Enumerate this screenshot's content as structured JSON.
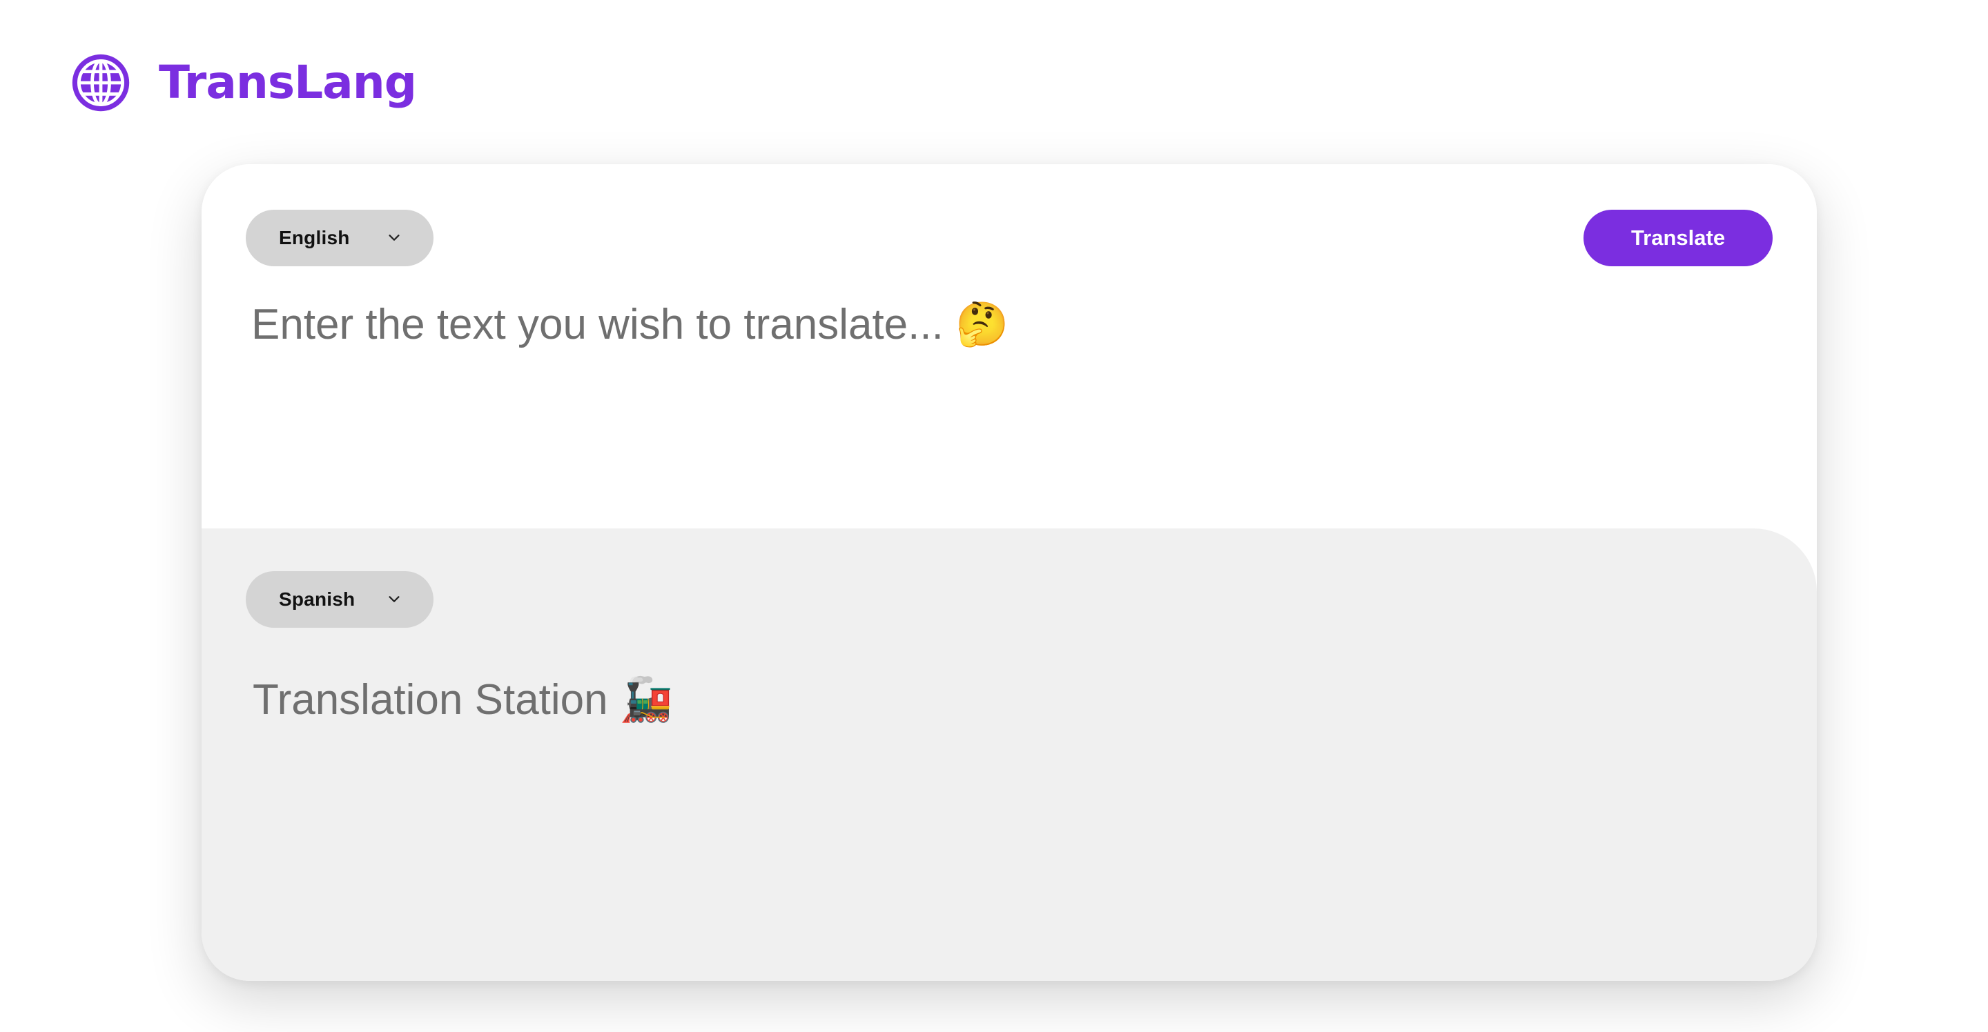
{
  "app": {
    "name": "TransLang",
    "logo_icon": "globe-icon"
  },
  "colors": {
    "brand": "#7b2ee0",
    "selector_background": "#d4d4d4",
    "output_background": "#f0f0f0",
    "text": "#6f6f6f"
  },
  "source": {
    "language": "English",
    "placeholder": "Enter the text you wish to translate... 🤔",
    "value": ""
  },
  "target": {
    "language": "Spanish",
    "text": "Translation Station 🚂"
  },
  "actions": {
    "translate_label": "Translate"
  },
  "icons": {
    "dropdown": "chevron-down-icon"
  }
}
